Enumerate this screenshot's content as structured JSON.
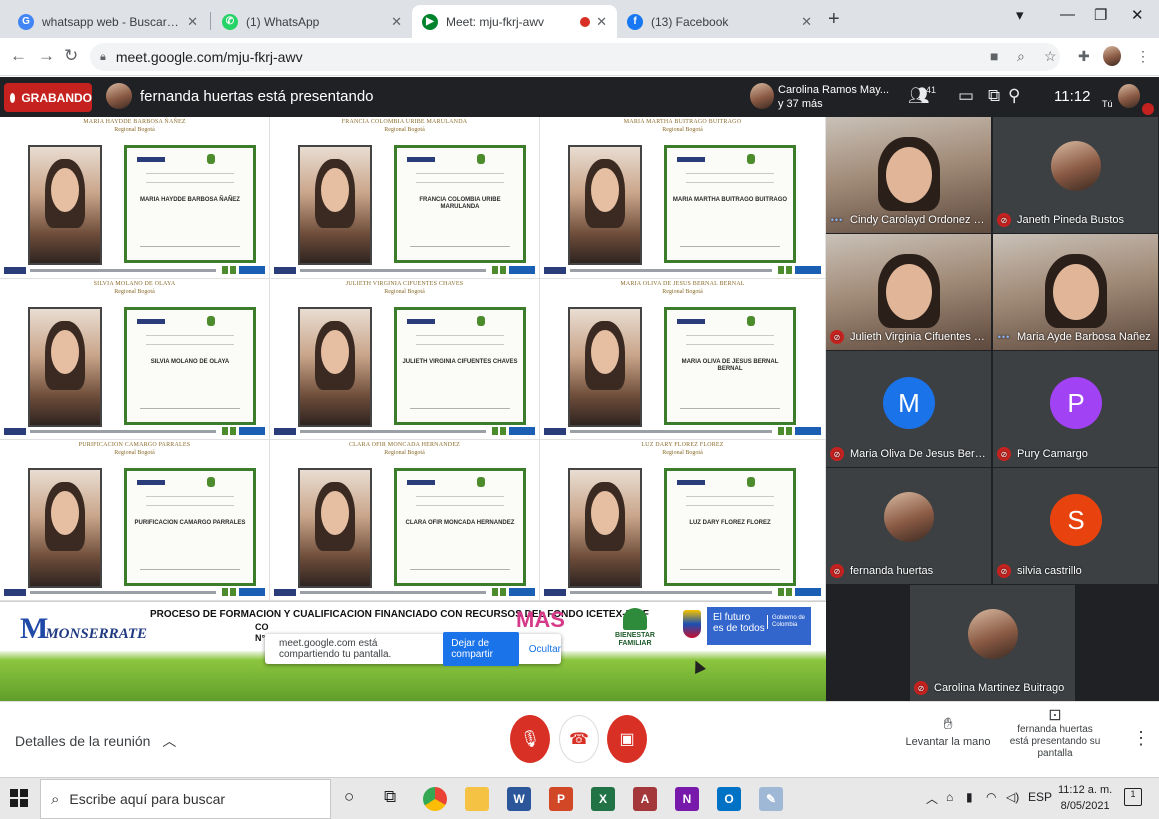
{
  "browser": {
    "tabs": [
      {
        "title": "whatsapp web - Buscar con Goo",
        "favicon": "G",
        "color": "#4285f4",
        "active": false
      },
      {
        "title": "(1) WhatsApp",
        "favicon": "✆",
        "color": "#25d366",
        "active": false
      },
      {
        "title": "Meet: mju-fkrj-awv",
        "favicon": "▶",
        "color": "#00832d",
        "active": true
      },
      {
        "title": "(13) Facebook",
        "favicon": "f",
        "color": "#1877f2",
        "active": false
      }
    ],
    "url": "meet.google.com/mju-fkrj-awv"
  },
  "meet_top": {
    "recording_label": "GRABANDO",
    "presenting_text": "fernanda huertas está presentando",
    "host_name_line1": "Carolina Ramos May...",
    "host_name_line2": "y 37 más",
    "participants_count": "41",
    "time": "11:12",
    "you_label": "Tú"
  },
  "shared_screen": {
    "certificates": [
      {
        "name": "MARIA HAYDDE BARBOSA ÑAÑEZ",
        "region": "Regional Bogotá",
        "cert_name": "MARIA HAYDDE BARBOSA ÑAÑEZ"
      },
      {
        "name": "FRANCIA COLOMBIA URIBE MARULANDA",
        "region": "Regional Bogotá",
        "cert_name": "FRANCIA COLOMBIA URIBE MARULANDA"
      },
      {
        "name": "MARIA MARTHA BUITRAGO BUITRAGO",
        "region": "Regional Bogotá",
        "cert_name": "MARIA MARTHA BUITRAGO BUITRAGO"
      },
      {
        "name": "SILVIA MOLANO DE OLAYA",
        "region": "Regional Bogotá",
        "cert_name": "SILVIA MOLANO DE OLAYA"
      },
      {
        "name": "JULIETH VIRGINIA CIFUENTES CHAVES",
        "region": "Regional Bogotá",
        "cert_name": "JULIETH VIRGINIA CIFUENTES CHAVES"
      },
      {
        "name": "MARIA OLIVA DE JESUS BERNAL BERNAL",
        "region": "Regional Bogotá",
        "cert_name": "MARIA OLIVA DE JESUS BERNAL BERNAL"
      },
      {
        "name": "PURIFICACION CAMARGO PARRALES",
        "region": "Regional Bogotá",
        "cert_name": "PURIFICACION CAMARGO PARRALES"
      },
      {
        "name": "CLARA OFIR MONCADA HERNANDEZ",
        "region": "Regional Bogotá",
        "cert_name": "CLARA OFIR MONCADA HERNANDEZ"
      },
      {
        "name": "LUZ DARY FLOREZ FLOREZ",
        "region": "Regional Bogotá",
        "cert_name": "LUZ DARY FLOREZ FLOREZ"
      }
    ],
    "banner": {
      "logo_text": "MONSERRATE",
      "title": "PROCESO DE FORMACION Y CUALIFICACION FINANCIADO CON RECURSOS DEL FONDO ICETEX-ICBF",
      "line2": "CO",
      "line3": "N° 2",
      "mas_logo": "MAS",
      "bienestar_label": "BIENESTAR FAMILIAR",
      "gov_line1": "El futuro",
      "gov_line2": "es de todos",
      "gov_sub": "Gobierno de Colombia"
    },
    "share_notice": {
      "text": "meet.google.com está compartiendo tu pantalla.",
      "stop_label": "Dejar de compartir",
      "hide_label": "Ocultar"
    }
  },
  "participants": [
    {
      "name": "Cindy Carolayd Ordonez Leon",
      "status": "speaking",
      "kind": "video"
    },
    {
      "name": "Janeth Pineda Bustos",
      "status": "muted",
      "kind": "avatar"
    },
    {
      "name": "Julieth Virginia Cifuentes Cha...",
      "status": "muted",
      "kind": "video"
    },
    {
      "name": "Maria Ayde Barbosa Nañez",
      "status": "speaking",
      "kind": "video"
    },
    {
      "name": "Maria Oliva De Jesus Bernal ...",
      "status": "muted",
      "kind": "letter",
      "letter": "M",
      "color": "#1a73e8"
    },
    {
      "name": "Pury Camargo",
      "status": "muted",
      "kind": "letter",
      "letter": "P",
      "color": "#a142f4"
    },
    {
      "name": "fernanda huertas",
      "status": "muted",
      "kind": "avatar"
    },
    {
      "name": "silvia castrillo",
      "status": "muted",
      "kind": "letter",
      "letter": "S",
      "color": "#e8430f"
    },
    {
      "name": "Carolina Martinez Buitrago",
      "status": "muted",
      "kind": "avatar"
    }
  ],
  "meet_bottom": {
    "details_label": "Detalles de la reunión",
    "raise_hand_label": "Levantar la mano",
    "present_line1": "fernanda huertas",
    "present_line2": "está presentando su pantalla"
  },
  "taskbar": {
    "search_placeholder": "Escribe aquí para buscar",
    "language": "ESP",
    "time": "11:12 a. m.",
    "date": "8/05/2021",
    "notification_count": "1"
  },
  "colors": {
    "recording": "#c5221f",
    "meet_dark": "#202124",
    "certificate_border": "#3b7d2a",
    "accent_blue": "#1a73e8"
  }
}
